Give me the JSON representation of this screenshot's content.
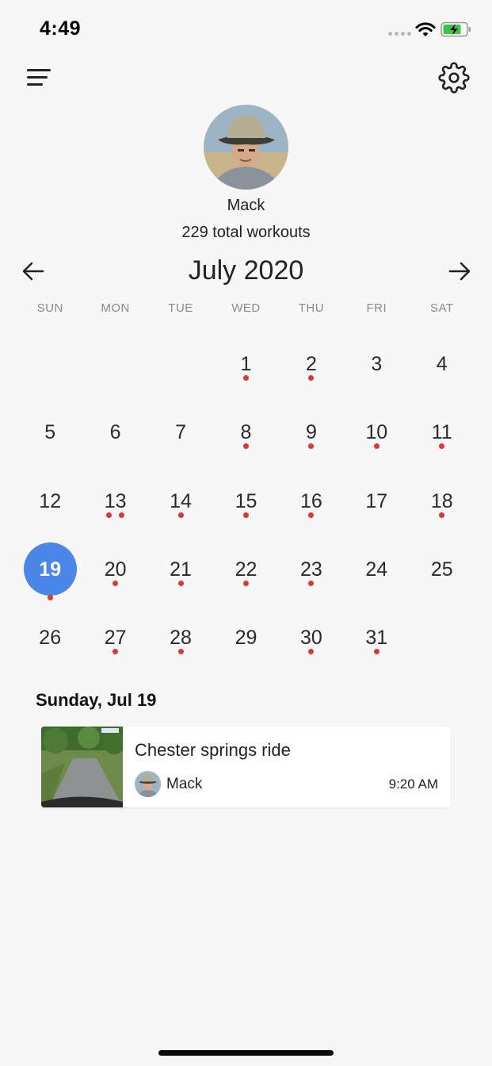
{
  "status_bar": {
    "time": "4:49"
  },
  "header": {
    "menu_icon": "hamburger-menu-icon",
    "settings_icon": "gear-icon"
  },
  "profile": {
    "name": "Mack",
    "total_workouts": "229 total workouts"
  },
  "calendar": {
    "month_label": "July 2020",
    "weekdays": [
      "SUN",
      "MON",
      "TUE",
      "WED",
      "THU",
      "FRI",
      "SAT"
    ],
    "selected_day": 19,
    "accent_color": "#4a86e8",
    "dot_color": "#d93a2b",
    "days": [
      {
        "day": "",
        "dots": 0
      },
      {
        "day": "",
        "dots": 0
      },
      {
        "day": "",
        "dots": 0
      },
      {
        "day": "1",
        "dots": 1
      },
      {
        "day": "2",
        "dots": 1
      },
      {
        "day": "3",
        "dots": 0
      },
      {
        "day": "4",
        "dots": 0
      },
      {
        "day": "5",
        "dots": 0
      },
      {
        "day": "6",
        "dots": 0
      },
      {
        "day": "7",
        "dots": 0
      },
      {
        "day": "8",
        "dots": 1
      },
      {
        "day": "9",
        "dots": 1
      },
      {
        "day": "10",
        "dots": 1
      },
      {
        "day": "11",
        "dots": 1
      },
      {
        "day": "12",
        "dots": 0
      },
      {
        "day": "13",
        "dots": 2
      },
      {
        "day": "14",
        "dots": 1
      },
      {
        "day": "15",
        "dots": 1
      },
      {
        "day": "16",
        "dots": 1
      },
      {
        "day": "17",
        "dots": 0
      },
      {
        "day": "18",
        "dots": 1
      },
      {
        "day": "19",
        "dots": 1
      },
      {
        "day": "20",
        "dots": 1
      },
      {
        "day": "21",
        "dots": 1
      },
      {
        "day": "22",
        "dots": 1
      },
      {
        "day": "23",
        "dots": 1
      },
      {
        "day": "24",
        "dots": 0
      },
      {
        "day": "25",
        "dots": 0
      },
      {
        "day": "26",
        "dots": 0
      },
      {
        "day": "27",
        "dots": 1
      },
      {
        "day": "28",
        "dots": 1
      },
      {
        "day": "29",
        "dots": 0
      },
      {
        "day": "30",
        "dots": 1
      },
      {
        "day": "31",
        "dots": 1
      }
    ]
  },
  "selected_day_section": {
    "heading": "Sunday, Jul 19",
    "workouts": [
      {
        "title": "Chester springs ride",
        "user": "Mack",
        "time": "9:20 AM"
      }
    ]
  }
}
